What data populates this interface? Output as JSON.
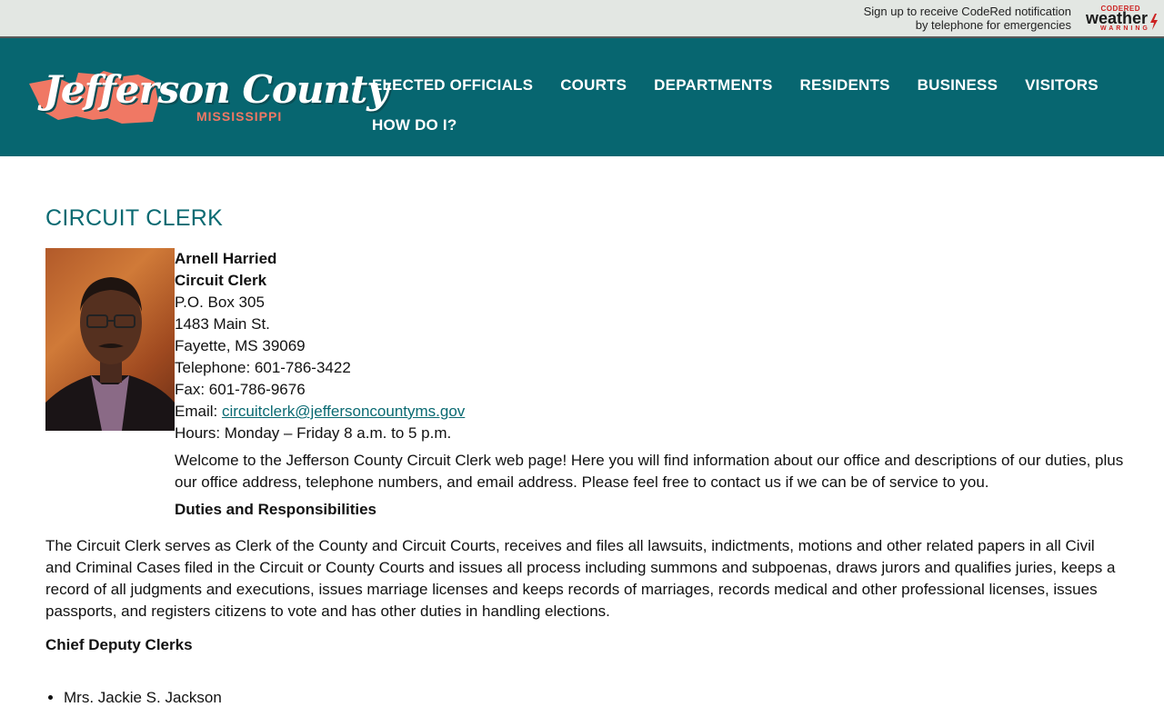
{
  "topbar": {
    "notice_line1": "Sign up to receive CodeRed notification",
    "notice_line2": "by telephone for emergencies",
    "logo_small": "CODERED",
    "logo_main": "weather",
    "logo_sub": "WARNING"
  },
  "header": {
    "logo_title": "Jefferson County",
    "logo_subtitle": "MISSISSIPPI",
    "nav": [
      "ELECTED OFFICIALS",
      "COURTS",
      "DEPARTMENTS",
      "RESIDENTS",
      "BUSINESS",
      "VISITORS",
      "HOW DO I?"
    ]
  },
  "main": {
    "page_title": "CIRCUIT CLERK",
    "profile": {
      "name": "Arnell Harried",
      "title": "Circuit Clerk",
      "po_box": "P.O. Box 305",
      "street": "1483 Main St.",
      "city": "Fayette, MS 39069",
      "telephone": "Telephone: 601-786-3422",
      "fax": "Fax: 601-786-9676",
      "email_label": "Email: ",
      "email": "circuitclerk@jeffersoncountyms.gov",
      "hours": "Hours: Monday – Friday 8 a.m. to 5 p.m."
    },
    "welcome": "Welcome to the Jefferson County Circuit Clerk web page! Here you will find information about our office and descriptions of our duties, plus our office address, telephone numbers, and email address. Please feel free to contact us if we can be of service to you.",
    "duties_heading": "Duties and Responsibilities",
    "duties_text": "The Circuit Clerk serves as Clerk of the County and Circuit Courts, receives and files all lawsuits, indictments, motions and other related papers in all Civil and Criminal Cases filed in the Circuit or County Courts and issues all process including summons and subpoenas, draws jurors and qualifies juries, keeps a record of all judgments and executions, issues marriage licenses and keeps records of marriages, records medical and other professional licenses, issues passports, and registers citizens to vote and has other duties in handling elections.",
    "chief_heading": "Chief Deputy Clerks",
    "chief_list": [
      "Mrs. Jackie S. Jackson"
    ]
  },
  "colors": {
    "header_bg": "#076670",
    "accent": "#0a6a72",
    "logo_state": "#f07864",
    "topbar_bg": "#e3e7e3"
  }
}
